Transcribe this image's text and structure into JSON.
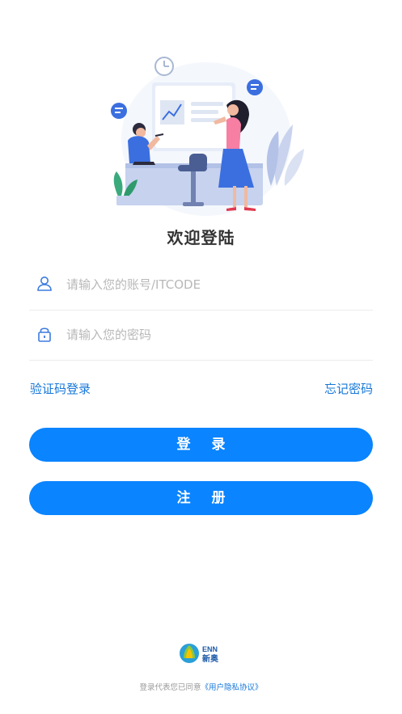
{
  "header": {
    "title": "欢迎登陆"
  },
  "form": {
    "account_placeholder": "请输入您的账号/ITCODE",
    "password_placeholder": "请输入您的密码"
  },
  "links": {
    "sms_login": "验证码登录",
    "forgot_password": "忘记密码"
  },
  "buttons": {
    "login": "登 录",
    "register": "注 册"
  },
  "footer": {
    "logo_en": "ENN",
    "logo_cn": "新奥",
    "agree_text": "登录代表您已同意",
    "protocol_link": "《用户隐私协议》"
  },
  "colors": {
    "accent": "#0a84ff",
    "link": "#1677d9",
    "placeholder": "#b8b8b8",
    "footer_text": "#9a9a9a"
  },
  "icons": [
    "clock-icon",
    "chat-bubble-icon",
    "chart-icon",
    "user-icon",
    "lock-icon"
  ]
}
